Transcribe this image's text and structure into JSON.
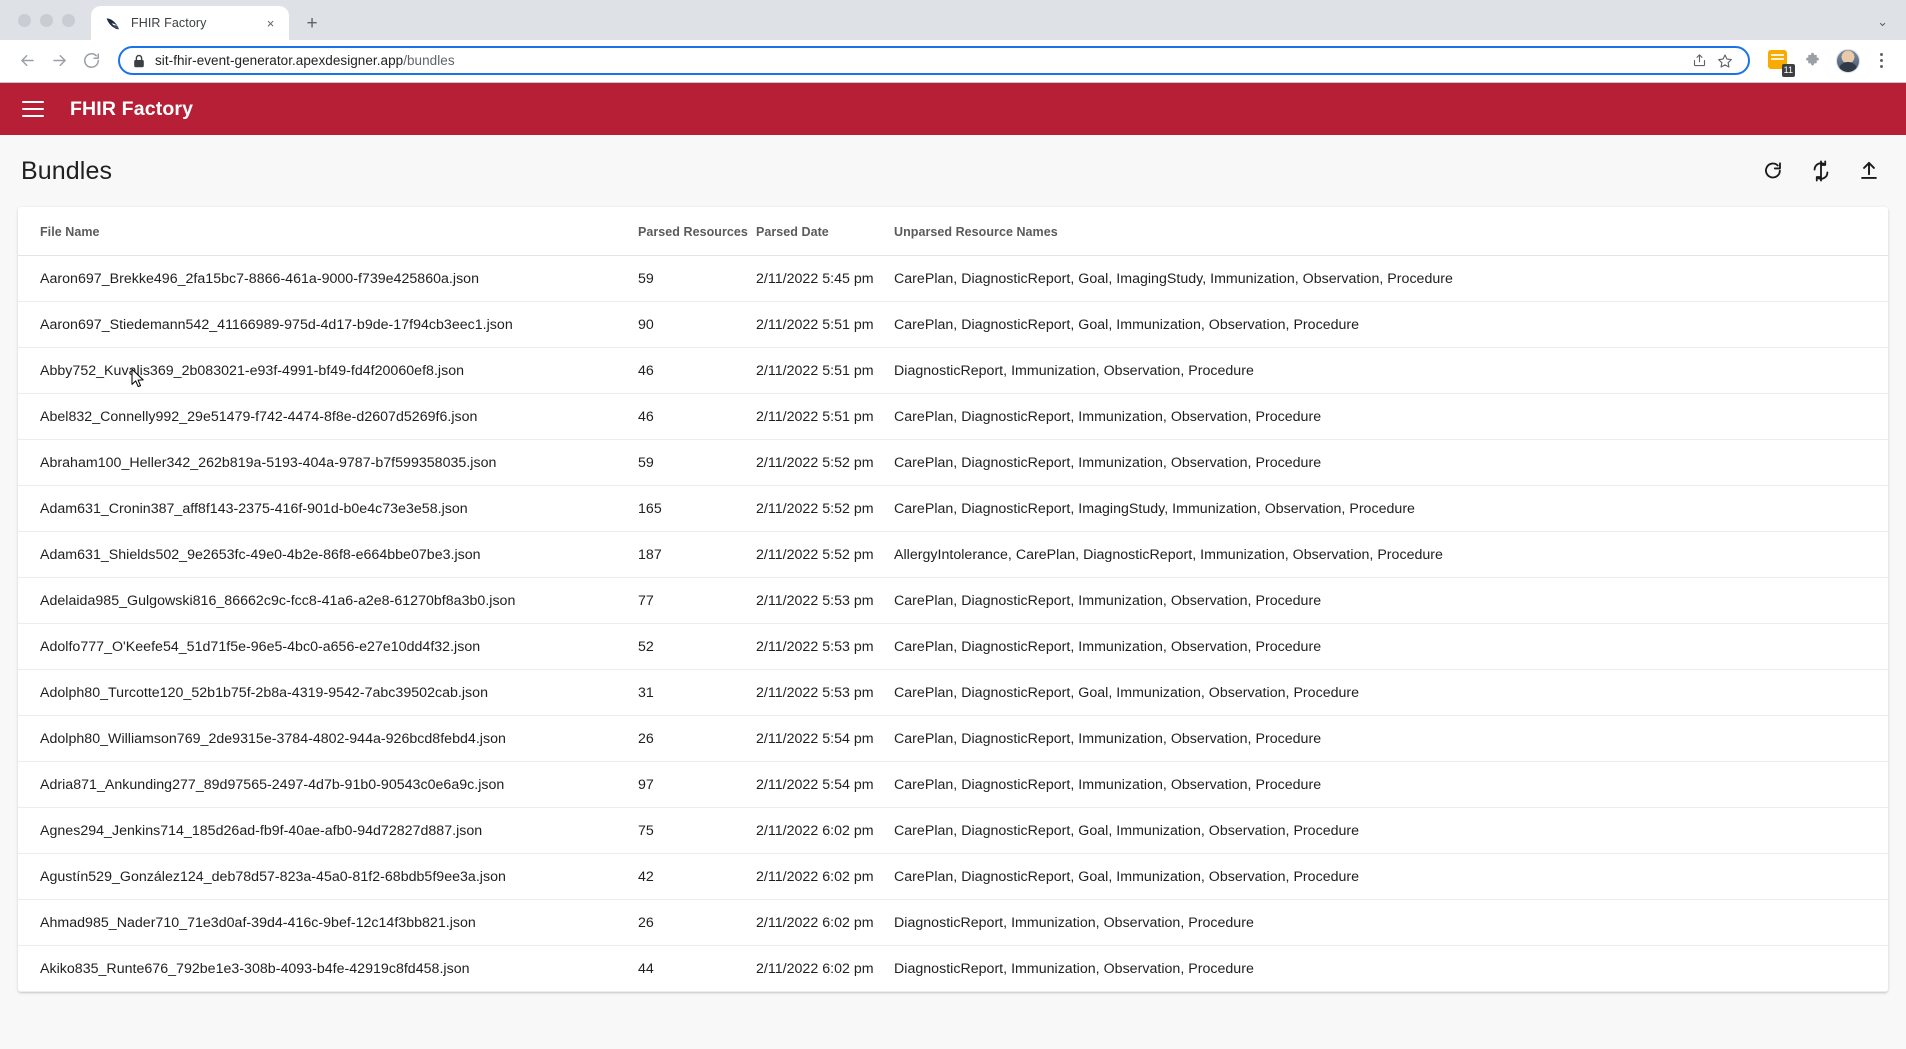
{
  "browser": {
    "tab": {
      "title": "FHIR Factory",
      "favicon": "swoosh-favicon",
      "close_label": "×"
    },
    "new_tab_label": "+",
    "collapse_label": "⌄",
    "nav": {
      "back": "←",
      "forward": "→",
      "reload": "⟳"
    },
    "omnibox": {
      "lock": "lock-icon",
      "url_host": "sit-fhir-event-generator.apexdesigner.app",
      "url_path": "/bundles",
      "share_label": "share-icon",
      "bookmark_label": "star-icon"
    },
    "extensions": {
      "badge_count": "11",
      "puzzle_label": "puzzle-icon"
    },
    "profile_label": "avatar",
    "menu_label": "kebab-menu"
  },
  "app": {
    "menu_label": "menu",
    "title": "FHIR Factory",
    "brand_color": "#b61f35"
  },
  "page": {
    "title": "Bundles",
    "actions": [
      {
        "name": "refresh-button",
        "icon": "refresh-icon"
      },
      {
        "name": "sync-button",
        "icon": "sync-icon"
      },
      {
        "name": "upload-button",
        "icon": "upload-icon"
      }
    ]
  },
  "table": {
    "columns": [
      "File Name",
      "Parsed Resources",
      "Parsed Date",
      "Unparsed Resource Names"
    ],
    "rows": [
      {
        "file": "Aaron697_Brekke496_2fa15bc7-8866-461a-9000-f739e425860a.json",
        "parsed": "59",
        "date": "2/11/2022 5:45 pm",
        "unparsed": "CarePlan, DiagnosticReport, Goal, ImagingStudy, Immunization, Observation, Procedure"
      },
      {
        "file": "Aaron697_Stiedemann542_41166989-975d-4d17-b9de-17f94cb3eec1.json",
        "parsed": "90",
        "date": "2/11/2022 5:51 pm",
        "unparsed": "CarePlan, DiagnosticReport, Goal, Immunization, Observation, Procedure"
      },
      {
        "file": "Abby752_Kuvalis369_2b083021-e93f-4991-bf49-fd4f20060ef8.json",
        "parsed": "46",
        "date": "2/11/2022 5:51 pm",
        "unparsed": "DiagnosticReport, Immunization, Observation, Procedure"
      },
      {
        "file": "Abel832_Connelly992_29e51479-f742-4474-8f8e-d2607d5269f6.json",
        "parsed": "46",
        "date": "2/11/2022 5:51 pm",
        "unparsed": "CarePlan, DiagnosticReport, Immunization, Observation, Procedure"
      },
      {
        "file": "Abraham100_Heller342_262b819a-5193-404a-9787-b7f599358035.json",
        "parsed": "59",
        "date": "2/11/2022 5:52 pm",
        "unparsed": "CarePlan, DiagnosticReport, Immunization, Observation, Procedure"
      },
      {
        "file": "Adam631_Cronin387_aff8f143-2375-416f-901d-b0e4c73e3e58.json",
        "parsed": "165",
        "date": "2/11/2022 5:52 pm",
        "unparsed": "CarePlan, DiagnosticReport, ImagingStudy, Immunization, Observation, Procedure"
      },
      {
        "file": "Adam631_Shields502_9e2653fc-49e0-4b2e-86f8-e664bbe07be3.json",
        "parsed": "187",
        "date": "2/11/2022 5:52 pm",
        "unparsed": "AllergyIntolerance, CarePlan, DiagnosticReport, Immunization, Observation, Procedure"
      },
      {
        "file": "Adelaida985_Gulgowski816_86662c9c-fcc8-41a6-a2e8-61270bf8a3b0.json",
        "parsed": "77",
        "date": "2/11/2022 5:53 pm",
        "unparsed": "CarePlan, DiagnosticReport, Immunization, Observation, Procedure"
      },
      {
        "file": "Adolfo777_O'Keefe54_51d71f5e-96e5-4bc0-a656-e27e10dd4f32.json",
        "parsed": "52",
        "date": "2/11/2022 5:53 pm",
        "unparsed": "CarePlan, DiagnosticReport, Immunization, Observation, Procedure"
      },
      {
        "file": "Adolph80_Turcotte120_52b1b75f-2b8a-4319-9542-7abc39502cab.json",
        "parsed": "31",
        "date": "2/11/2022 5:53 pm",
        "unparsed": "CarePlan, DiagnosticReport, Goal, Immunization, Observation, Procedure"
      },
      {
        "file": "Adolph80_Williamson769_2de9315e-3784-4802-944a-926bcd8febd4.json",
        "parsed": "26",
        "date": "2/11/2022 5:54 pm",
        "unparsed": "CarePlan, DiagnosticReport, Immunization, Observation, Procedure"
      },
      {
        "file": "Adria871_Ankunding277_89d97565-2497-4d7b-91b0-90543c0e6a9c.json",
        "parsed": "97",
        "date": "2/11/2022 5:54 pm",
        "unparsed": "CarePlan, DiagnosticReport, Immunization, Observation, Procedure"
      },
      {
        "file": "Agnes294_Jenkins714_185d26ad-fb9f-40ae-afb0-94d72827d887.json",
        "parsed": "75",
        "date": "2/11/2022 6:02 pm",
        "unparsed": "CarePlan, DiagnosticReport, Goal, Immunization, Observation, Procedure"
      },
      {
        "file": "Agustín529_González124_deb78d57-823a-45a0-81f2-68bdb5f9ee3a.json",
        "parsed": "42",
        "date": "2/11/2022 6:02 pm",
        "unparsed": "CarePlan, DiagnosticReport, Goal, Immunization, Observation, Procedure"
      },
      {
        "file": "Ahmad985_Nader710_71e3d0af-39d4-416c-9bef-12c14f3bb821.json",
        "parsed": "26",
        "date": "2/11/2022 6:02 pm",
        "unparsed": "DiagnosticReport, Immunization, Observation, Procedure"
      },
      {
        "file": "Akiko835_Runte676_792be1e3-308b-4093-b4fe-42919c8fd458.json",
        "parsed": "44",
        "date": "2/11/2022 6:02 pm",
        "unparsed": "DiagnosticReport, Immunization, Observation, Procedure"
      }
    ]
  }
}
